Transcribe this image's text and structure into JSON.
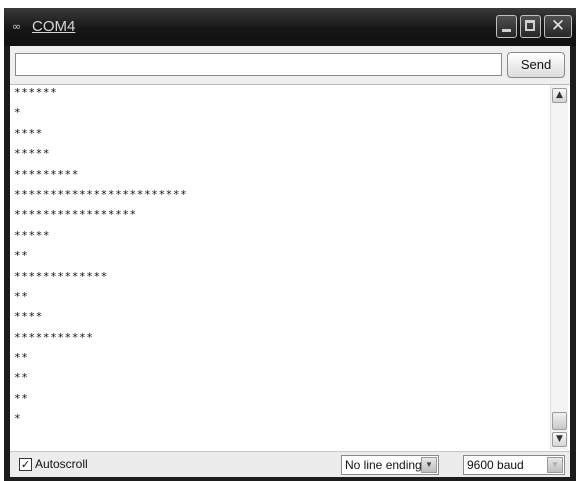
{
  "window": {
    "title": "COM4",
    "title_icon": "∞",
    "minimize_icon": "minimize-icon",
    "maximize_icon": "maximize-icon",
    "close_icon": "close-icon",
    "close_glyph": "✕"
  },
  "toolbar": {
    "input_value": "",
    "input_placeholder": "",
    "send_label": "Send"
  },
  "output": {
    "lines": [
      "******",
      "*",
      "****",
      "*****",
      "*********",
      "************************",
      "*****************",
      "*****",
      "**",
      "*************",
      "**",
      "****",
      "***********",
      "**",
      "**",
      "**",
      "*"
    ]
  },
  "statusbar": {
    "autoscroll_checked": "✓",
    "autoscroll_label": "Autoscroll",
    "line_ending": "No line ending",
    "baud": "9600 baud"
  },
  "colors": {
    "titlebar": "#1c1c1c",
    "client_bg": "#efefef"
  }
}
